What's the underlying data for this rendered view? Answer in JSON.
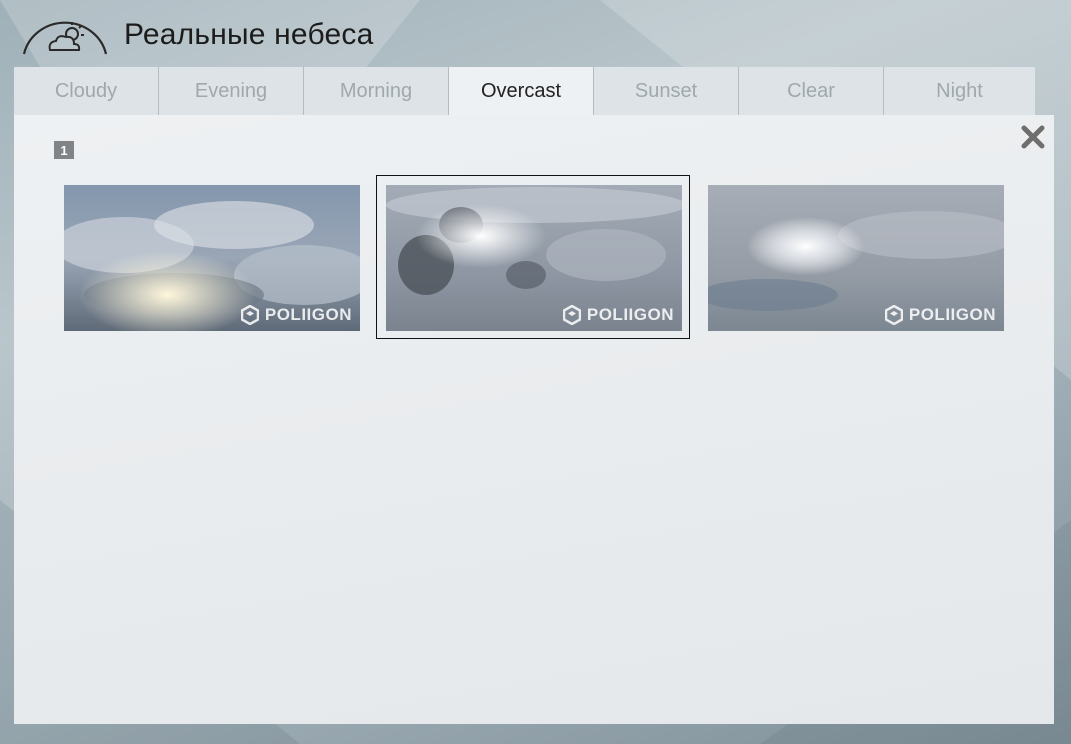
{
  "app": {
    "title": "Реальные небеса"
  },
  "tabs": [
    {
      "label": "Cloudy"
    },
    {
      "label": "Evening"
    },
    {
      "label": "Morning"
    },
    {
      "label": "Overcast"
    },
    {
      "label": "Sunset"
    },
    {
      "label": "Clear"
    },
    {
      "label": "Night"
    }
  ],
  "active_tab": "Overcast",
  "page_indicator": "1",
  "thumbnails": [
    {
      "watermark": "POLIIGON",
      "selected": false
    },
    {
      "watermark": "POLIIGON",
      "selected": true
    },
    {
      "watermark": "POLIIGON",
      "selected": false
    }
  ],
  "icons": {
    "logo": "cloud-sun-dome-icon",
    "close": "close-icon",
    "watermark": "poliigon-logo-icon"
  },
  "colors": {
    "panel": "#eef1f3",
    "tab_inactive_text": "#a0a8ad",
    "tab_active_text": "#222222",
    "badge": "#808486"
  }
}
